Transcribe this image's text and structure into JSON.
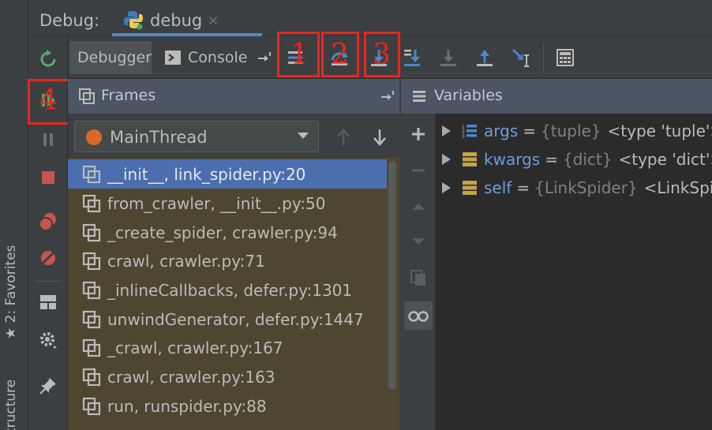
{
  "header": {
    "title": "Debug:",
    "tab_label": "debug",
    "tab_close": "×"
  },
  "stripe": {
    "favorites": "2: Favorites",
    "structure": "Structure"
  },
  "toolbar": {
    "debugger_tab": "Debugger",
    "console_tab": "Console",
    "markers": [
      "1",
      "2",
      "3",
      "4"
    ]
  },
  "frames": {
    "title": "Frames",
    "thread": "MainThread",
    "items": [
      "__init__, link_spider.py:20",
      "from_crawler, __init__.py:50",
      "_create_spider, crawler.py:94",
      "crawl, crawler.py:71",
      "_inlineCallbacks, defer.py:1301",
      "unwindGenerator, defer.py:1447",
      "_crawl, crawler.py:167",
      "crawl, crawler.py:163",
      "run, runspider.py:88"
    ]
  },
  "variables": {
    "title": "Variables",
    "items": [
      {
        "name": "args",
        "eq": "=",
        "type": "{tuple}",
        "value": "<type 'tuple'>"
      },
      {
        "name": "kwargs",
        "eq": "=",
        "type": "{dict}",
        "value": "<type 'dict'>"
      },
      {
        "name": "self",
        "eq": "=",
        "type": "{LinkSpider}",
        "value": "<LinkSpid"
      }
    ]
  },
  "colors": {
    "accent": "#4a88c7",
    "selection": "#4b6eaf",
    "marker": "#e8261c",
    "frames_bg": "#4e4631"
  }
}
